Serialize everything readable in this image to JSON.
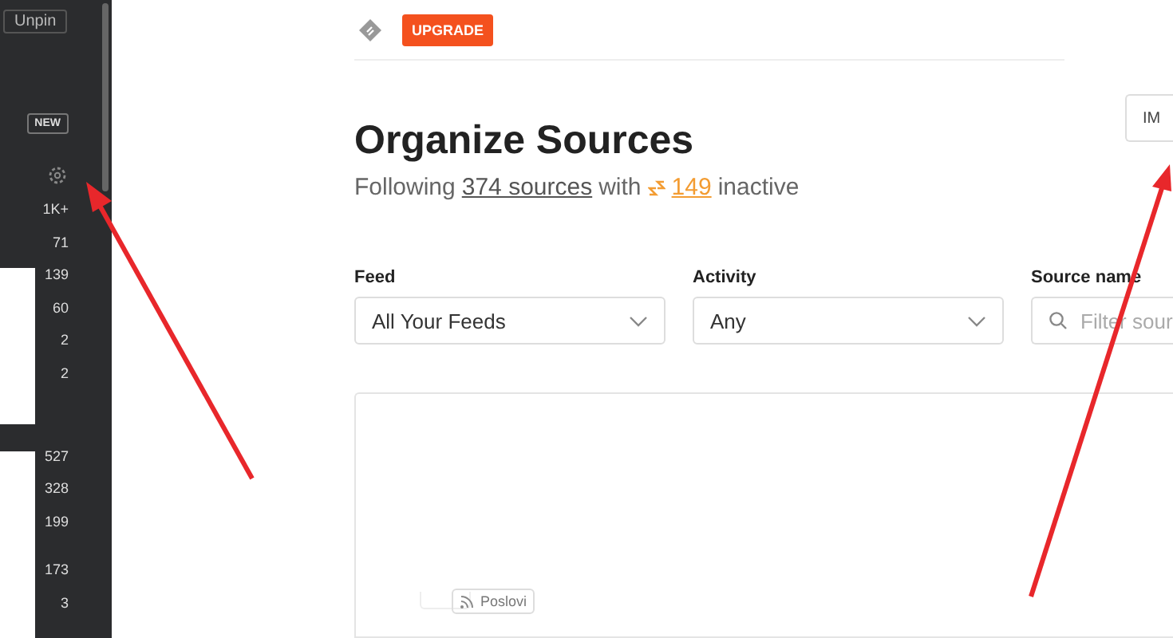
{
  "sidebar": {
    "unpin": "Unpin",
    "new_badge": "NEW",
    "count_groups": [
      [
        "1K+",
        "71",
        "139",
        "60",
        "2",
        "2"
      ],
      [
        "527",
        "328",
        "199"
      ],
      [
        "173",
        "3"
      ]
    ]
  },
  "topbar": {
    "upgrade": "UPGRADE"
  },
  "header": {
    "title": "Organize Sources",
    "following": "Following",
    "sources_link": "374 sources",
    "with": "with",
    "inactive_count": "149",
    "inactive": "inactive",
    "action_button": "IM"
  },
  "filters": [
    {
      "label": "Feed",
      "kind": "select",
      "value": "All Your Feeds"
    },
    {
      "label": "Activity",
      "kind": "select",
      "value": "Any"
    },
    {
      "label": "Source name",
      "kind": "search",
      "placeholder": "Filter sour"
    }
  ],
  "list": {
    "tag": "Poslovi"
  }
}
